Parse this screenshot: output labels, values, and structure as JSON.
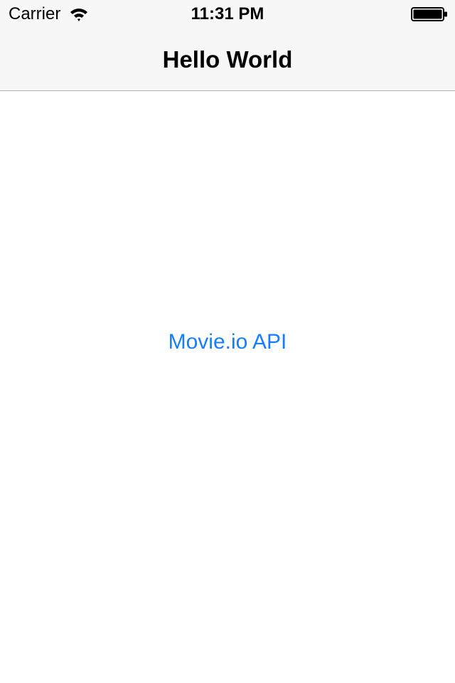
{
  "status_bar": {
    "carrier": "Carrier",
    "time": "11:31 PM",
    "wifi_icon": "wifi-icon",
    "battery_icon": "battery-icon"
  },
  "nav_bar": {
    "title": "Hello World"
  },
  "main": {
    "api_button_label": "Movie.io API"
  },
  "colors": {
    "accent": "#157efb",
    "nav_background": "#f7f7f7",
    "nav_border": "#b2b2b2",
    "background": "#ffffff"
  }
}
